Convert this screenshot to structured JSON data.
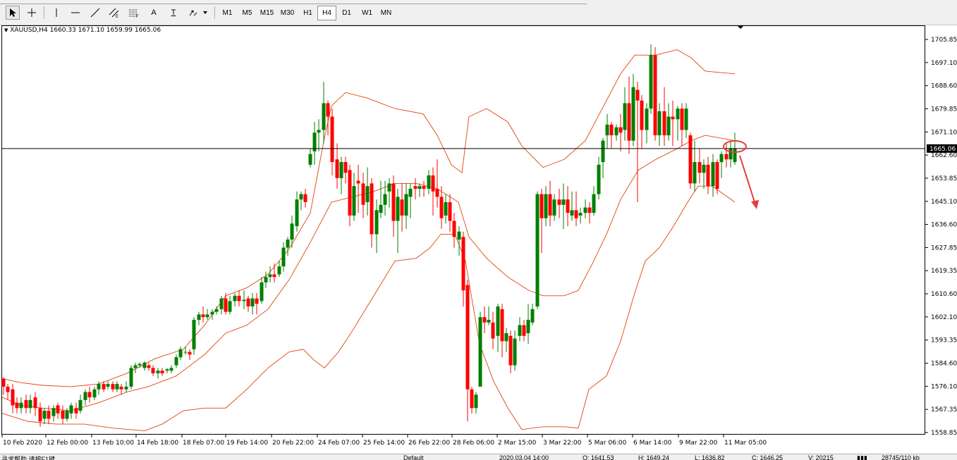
{
  "toolbar": {
    "tools": [
      {
        "name": "cursor-icon"
      },
      {
        "name": "crosshair-icon"
      },
      {
        "name": "vertical-line-icon"
      },
      {
        "name": "horizontal-line-icon"
      },
      {
        "name": "trendline-icon"
      },
      {
        "name": "equidistant-channel-icon"
      },
      {
        "name": "fibonacci-icon"
      },
      {
        "name": "text-label-icon",
        "label": "A"
      },
      {
        "name": "text-box-icon",
        "label": "T"
      },
      {
        "name": "arrows-icon"
      }
    ],
    "timeframes": [
      "M1",
      "M5",
      "M15",
      "M30",
      "H1",
      "H4",
      "D1",
      "W1",
      "MN"
    ],
    "active_timeframe": "H4"
  },
  "chart": {
    "symbol_info": "XAUUSD,H4  1660.33 1671.10 1659.99 1665.06",
    "current_price_label": "1665.06",
    "y_ticks": [
      "1705.85",
      "1697.10",
      "1688.60",
      "1679.85",
      "1671.10",
      "1662.60",
      "1653.85",
      "1645.10",
      "1636.60",
      "1627.85",
      "1619.35",
      "1610.60",
      "1602.10",
      "1593.35",
      "1584.60",
      "1576.10",
      "1567.35",
      "1558.85"
    ],
    "x_ticks": [
      "10 Feb 2020",
      "12 Feb 00:00",
      "13 Feb 10:00",
      "14 Feb 18:00",
      "18 Feb 07:00",
      "19 Feb 14:00",
      "20 Feb 22:00",
      "24 Feb 07:00",
      "25 Feb 14:00",
      "26 Feb 22:00",
      "28 Feb 06:00",
      "2 Mar 15:00",
      "3 Mar 22:00",
      "5 Mar 06:00",
      "6 Mar 14:00",
      "9 Mar 22:00",
      "11 Mar 05:00"
    ],
    "colors": {
      "bull": "#007f00",
      "bear": "#ff0000",
      "band": "#e0440a",
      "annotation": "#e53c3c"
    },
    "price_min": 1556.5,
    "price_max": 1709.0
  },
  "status_bar": {
    "help_text": "寻求帮助,请按F1键",
    "profile": "Default",
    "datetime": "2020.03.04 14:00",
    "open": "O: 1641.53",
    "high": "H: 1649.24",
    "low": "L: 1636.82",
    "close": "C: 1646.25",
    "volume": "V: 20215",
    "traffic": "28745/110 kb"
  }
}
